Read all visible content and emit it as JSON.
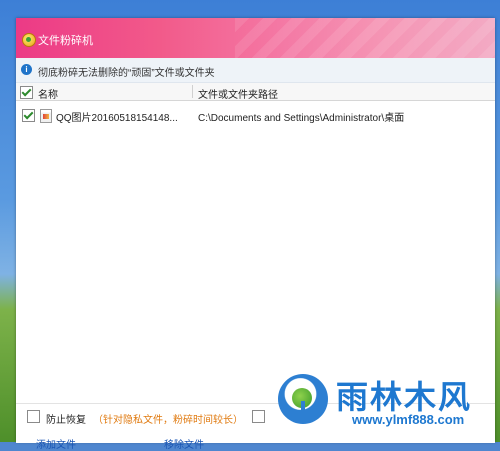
{
  "window": {
    "title": "文件粉碎机"
  },
  "info": {
    "text": "彻底粉碎无法删除的“顽固”文件或文件夹"
  },
  "table": {
    "columns": [
      "名称",
      "文件或文件夹路径"
    ],
    "rows": [
      {
        "checked": true,
        "name": "QQ图片20160518154148...",
        "path": "C:\\Documents and Settings\\Administrator\\桌面"
      }
    ]
  },
  "footer": {
    "prevent_restore_label": "防止恢复",
    "prevent_restore_hint": "（针对隐私文件，粉碎时间较长）",
    "link_add": "添加文件",
    "link_remove": "移除文件"
  },
  "watermark": {
    "text": "雨林木风",
    "url": "www.ylmf888.com"
  },
  "colors": {
    "titlebar_start": "#ec3a86",
    "titlebar_end": "#f3aac4",
    "link": "#1a55b3",
    "hint": "#e07a10",
    "watermark": "#1e78d0"
  }
}
